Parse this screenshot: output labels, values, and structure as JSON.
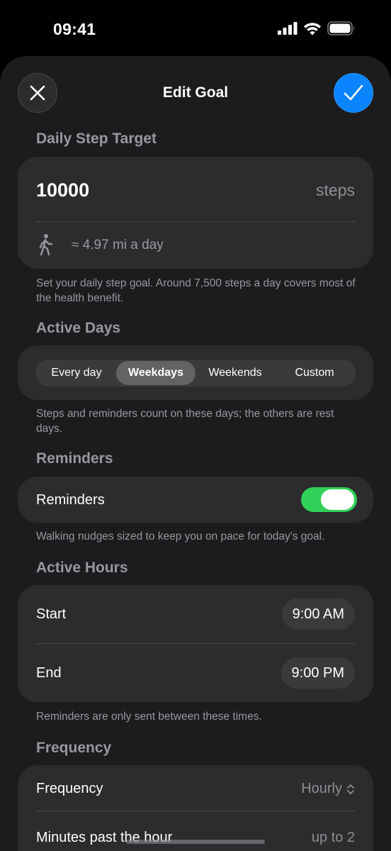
{
  "status": {
    "time": "09:41"
  },
  "nav": {
    "title": "Edit Goal",
    "close_icon": "close-icon",
    "confirm_icon": "checkmark-icon"
  },
  "step_target": {
    "header": "Daily Step Target",
    "value": "10000",
    "unit": "steps",
    "distance": "≈ 4.97 mi a day",
    "footnote": "Set your daily step goal. Around 7,500 steps a day covers most of the health benefit."
  },
  "active_days": {
    "header": "Active Days",
    "options": [
      "Every day",
      "Weekdays",
      "Weekends",
      "Custom"
    ],
    "selected": "Weekdays",
    "footnote": "Steps and reminders count on these days; the others are rest days."
  },
  "reminders": {
    "header": "Reminders",
    "label": "Reminders",
    "enabled": true,
    "footnote": "Walking nudges sized to keep you on pace for today's goal."
  },
  "active_hours": {
    "header": "Active Hours",
    "start_label": "Start",
    "start_value": "9:00 AM",
    "end_label": "End",
    "end_value": "9:00 PM",
    "footnote": "Reminders are only sent between these times."
  },
  "frequency": {
    "header": "Frequency",
    "frequency_label": "Frequency",
    "frequency_value": "Hourly",
    "minutes_label": "Minutes past the hour",
    "minutes_value": "up to 2"
  },
  "colors": {
    "accent": "#0a84ff",
    "toggle_on": "#30d158",
    "background": "#1c1c1e",
    "card": "#2c2c2e"
  }
}
